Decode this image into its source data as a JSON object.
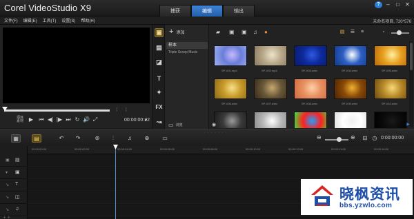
{
  "window": {
    "title": "Corel VideoStudio X9",
    "tabs": [
      {
        "label": "捕获",
        "active": false
      },
      {
        "label": "编辑",
        "active": true
      },
      {
        "label": "输出",
        "active": false
      }
    ],
    "controls": [
      "?",
      "–",
      "□",
      "✕"
    ]
  },
  "menu": {
    "items": [
      "文件(F)",
      "编辑(E)",
      "工具(T)",
      "设置(S)",
      "帮助(H)"
    ],
    "project_info": "未命名项目, 720*576"
  },
  "preview": {
    "mode_label_top": "项目",
    "mode_label_bottom": "素材",
    "buttons": [
      "▶",
      "⏮",
      "◀|",
      "|▶",
      "⏭",
      "↻",
      "🔊",
      "⤢"
    ],
    "timecode": "00:00:00:22"
  },
  "library": {
    "side_icons": [
      {
        "name": "media",
        "glyph": "▣"
      },
      {
        "name": "instant-project",
        "glyph": "▤"
      },
      {
        "name": "transition",
        "glyph": "◪"
      },
      {
        "name": "title",
        "glyph": "T"
      },
      {
        "name": "graphic",
        "glyph": "✦"
      },
      {
        "name": "filter",
        "glyph": "FX"
      },
      {
        "name": "path",
        "glyph": "↝"
      }
    ],
    "add_label": "添加",
    "folders": [
      "样本",
      "Triple Scoop Music"
    ],
    "browse_label": "浏览",
    "thumbnails": [
      {
        "label": "SP-V01.mp4",
        "colors": [
          "#6a7ed8",
          "#c8b9ff",
          "#9fb0f0"
        ]
      },
      {
        "label": "SP-V02.mp4",
        "colors": [
          "#b8a98a",
          "#efe4cc",
          "#8a7a60"
        ]
      },
      {
        "label": "SP-V03.wmv",
        "colors": [
          "#0d2a9c",
          "#2f58e0",
          "#0a1a6a"
        ]
      },
      {
        "label": "SP-V04.wmv",
        "colors": [
          "#2c5fc4",
          "#ffffff",
          "#123a88"
        ]
      },
      {
        "label": "SP-V05.wmv",
        "colors": [
          "#e8a020",
          "#fff0a0",
          "#b86a08"
        ]
      },
      {
        "label": "SP-V06.wmv",
        "colors": [
          "#c89a2a",
          "#f8e08a",
          "#8a6a18"
        ]
      },
      {
        "label": "SP-V07.wmv",
        "colors": [
          "#6a5a3a",
          "#c8a870",
          "#3a2a1a"
        ]
      },
      {
        "label": "SP-V08.wmv",
        "colors": [
          "#e89060",
          "#ffd0a8",
          "#d06a40"
        ]
      },
      {
        "label": "SP-V09.wmv",
        "colors": [
          "#8a4a08",
          "#f0b030",
          "#4a2404"
        ]
      },
      {
        "label": "SP-V10.wmv",
        "colors": [
          "#b88a28",
          "#f8d878",
          "#6a4a10"
        ]
      },
      {
        "label": "",
        "colors": [
          "#3a3a3a",
          "#9a9a9a",
          "#1a1a1a"
        ]
      },
      {
        "label": "",
        "colors": [
          "#b8b8b8",
          "#ffffff",
          "#888888"
        ]
      },
      {
        "label": "",
        "colors": [
          "#ff2020",
          "#20a0ff",
          "#20ff40"
        ]
      },
      {
        "label": "",
        "colors": [
          "#ffffff",
          "#f0f0f0",
          "#dcdcdc"
        ]
      },
      {
        "label": "",
        "colors": [
          "#0a0a0a",
          "#1a1a1a",
          "#000000"
        ]
      }
    ]
  },
  "timeline": {
    "timecode": "0:00:00:00",
    "ruler": [
      "00:00:00:00",
      "00:00:02:00",
      "00:00:04:00",
      "00:00:06:00",
      "00:00:08:00",
      "00:00:10:00",
      "00:00:12:00",
      "00:00:14:00",
      "00:00:16:00"
    ],
    "tracks": [
      "视频轨",
      "叠加轨",
      "标题轨",
      "声音轨",
      "音乐轨"
    ]
  },
  "watermark": {
    "title": "晓枫资讯",
    "url": "bbs.yzwlo.com"
  }
}
